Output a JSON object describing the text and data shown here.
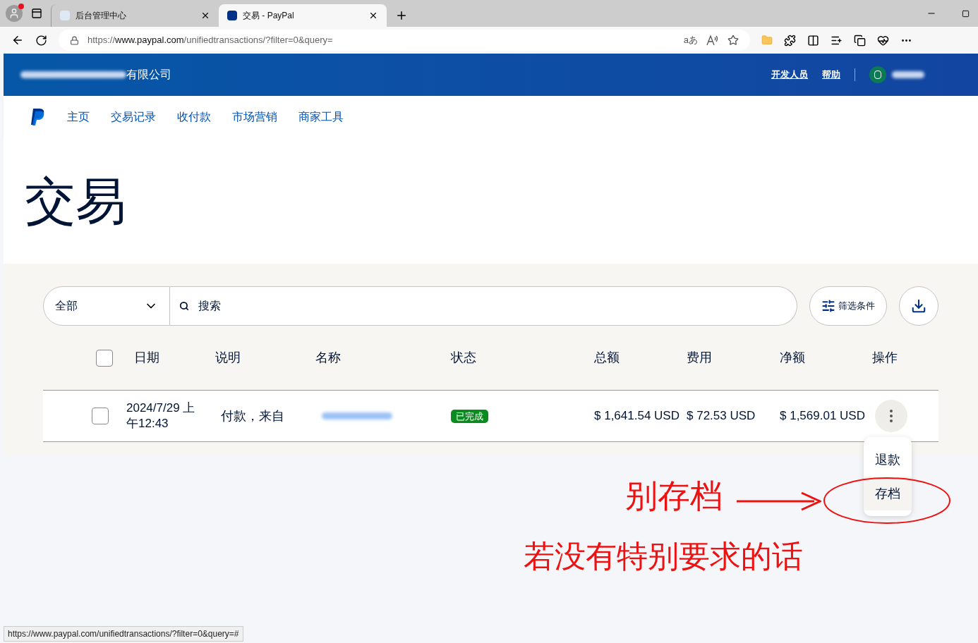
{
  "browser": {
    "tabs": [
      {
        "title": "后台管理中心",
        "selected": false
      },
      {
        "title": "交易 - PayPal",
        "selected": true
      }
    ],
    "url_scheme": "https://",
    "url_host": "www.paypal.com",
    "url_path": "/unifiedtransactions/?filter=0&query=",
    "translate_glyph": "aあ"
  },
  "header": {
    "company_suffix": "有限公司",
    "links": [
      "开发人员",
      "帮助"
    ]
  },
  "nav": {
    "items": [
      "主页",
      "交易记录",
      "收付款",
      "市场营销",
      "商家工具"
    ]
  },
  "page_title": "交易",
  "toolbar": {
    "type_filter": "全部",
    "search_placeholder": "搜索",
    "filter_button": "筛选条件"
  },
  "table": {
    "select_all_checked": false,
    "columns": [
      "日期",
      "说明",
      "名称",
      "状态",
      "总额",
      "费用",
      "净额",
      "操作"
    ],
    "rows": [
      {
        "checked": false,
        "date": "2024/7/29 上午12:43",
        "description": "付款，来自",
        "status": "已完成",
        "gross": "$ 1,641.54 USD",
        "fee": "$ 72.53 USD",
        "net": "$ 1,569.01 USD"
      }
    ]
  },
  "action_menu": {
    "items": [
      {
        "label": "退款",
        "selected": false
      },
      {
        "label": "存档",
        "selected": true
      }
    ]
  },
  "annotations": {
    "label": "别存档",
    "note": "若没有特别要求的话"
  },
  "status_bar": "https://www.paypal.com/unifiedtransactions/?filter=0&query=#"
}
